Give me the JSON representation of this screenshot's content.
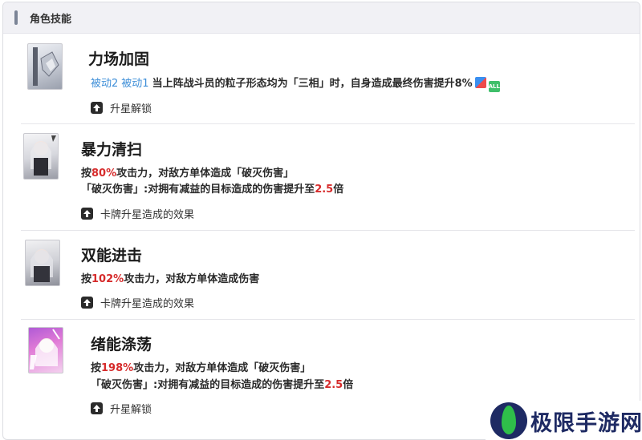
{
  "header": {
    "title": "角色技能"
  },
  "skills": [
    {
      "name": "力场加固",
      "tags": [
        "被动2",
        "被动1"
      ],
      "desc_pre": "当上阵战斗员的粒子形态均为「三相」时，自身造成最终伤害提升8%",
      "icons": [
        "color-element-icon",
        "all-badge-icon"
      ],
      "badge_all": "ALL",
      "upgrade": "升星解锁"
    },
    {
      "name": "暴力清扫",
      "l1_pre": "按",
      "l1_hl": "80%",
      "l1_post": "攻击力，对敌方单体造成「破灭伤害」",
      "l2_pre": "「破灭伤害」:对拥有减益的目标造成的伤害提升至",
      "l2_hl": "2.5",
      "l2_post": "倍",
      "upgrade": "卡牌升星造成的效果"
    },
    {
      "name": "双能进击",
      "l1_pre": "按",
      "l1_hl": "102%",
      "l1_post": "攻击力，对敌方单体造成伤害",
      "upgrade": "卡牌升星造成的效果"
    },
    {
      "name": "绪能涤荡",
      "l1_pre": "按",
      "l1_hl": "198%",
      "l1_post": "攻击力，对敌方单体造成「破灭伤害」",
      "l2_pre": "「破灭伤害」:对拥有减益的目标造成的伤害提升至",
      "l2_hl": "2.5",
      "l2_post": "倍",
      "upgrade": "升星解锁"
    }
  ],
  "watermark": {
    "text": "极限手游网"
  },
  "colors": {
    "highlight": "#d62b2b",
    "tag": "#3f8fd8",
    "header_bg": "#f1f1f5"
  }
}
